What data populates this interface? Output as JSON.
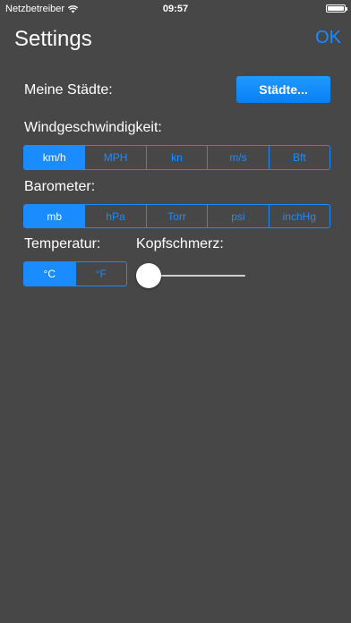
{
  "status_bar": {
    "carrier": "Netzbetreiber",
    "time": "09:57"
  },
  "nav": {
    "title": "Settings",
    "ok_label": "OK"
  },
  "cities": {
    "label": "Meine Städte:",
    "button_label": "Städte..."
  },
  "wind": {
    "label": "Windgeschwindigkeit:",
    "options": [
      "km/h",
      "MPH",
      "kn",
      "m/s",
      "Bft"
    ],
    "selected": "km/h"
  },
  "barometer": {
    "label": "Barometer:",
    "options": [
      "mb",
      "hPa",
      "Torr",
      "psi",
      "inchHg"
    ],
    "selected": "mb"
  },
  "temperature": {
    "label": "Temperatur:",
    "options": [
      "°C",
      "°F"
    ],
    "selected": "°C"
  },
  "headache": {
    "label": "Kopfschmerz:",
    "slider_value": 0
  },
  "colors": {
    "background": "#474747",
    "accent": "#1a8cff"
  }
}
